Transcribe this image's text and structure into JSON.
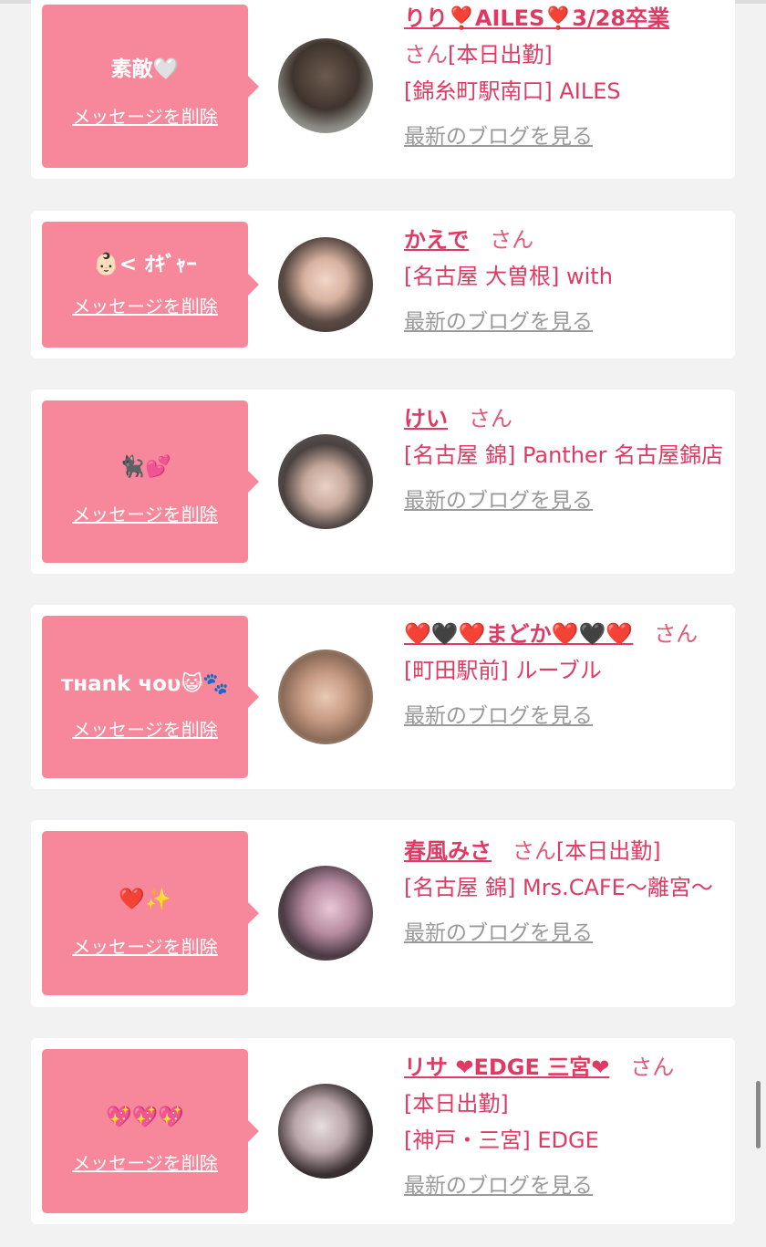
{
  "colors": {
    "bubble": "#f7889b",
    "name_text": "#e03a64",
    "blog_link": "#9a9a9a",
    "background": "#f2f2f2"
  },
  "entries": [
    {
      "message": "素敵🤍",
      "delete_label": "メッセージを削除",
      "name": "りり❣️AILES❣️3/28卒業",
      "san": "さん",
      "status": "[本日出勤]",
      "shop": "[錦糸町駅南口] AILES",
      "blog_label": "最新のブログを見る"
    },
    {
      "message": "👶🏻< ｵｷﾞｬｰ",
      "delete_label": "メッセージを削除",
      "name": "かえで",
      "san": "さん",
      "status": "",
      "shop": "[名古屋 大曽根] with",
      "blog_label": "最新のブログを見る"
    },
    {
      "message": "🐈‍⬛💕",
      "delete_label": "メッセージを削除",
      "name": "けい",
      "san": "さん",
      "status": "",
      "shop": "[名古屋 錦] Panther 名古屋錦店",
      "blog_label": "最新のブログを見る"
    },
    {
      "message": "тнank чoυ😺🐾",
      "delete_label": "メッセージを削除",
      "name": "❤️🖤❤️まどか❤️🖤❤️",
      "san": "さん",
      "status": "",
      "shop": "[町田駅前] ルーブル",
      "blog_label": "最新のブログを見る"
    },
    {
      "message": "❤️✨",
      "delete_label": "メッセージを削除",
      "name": "春風みさ",
      "san": "さん",
      "status": "[本日出勤]",
      "shop": "[名古屋 錦] Mrs.CAFE〜離宮〜",
      "blog_label": "最新のブログを見る"
    },
    {
      "message": "💖💖💖",
      "delete_label": "メッセージを削除",
      "name": "リサ ❤EDGE 三宮❤",
      "san": "さん",
      "status": "[本日出勤]",
      "shop": "[神戸・三宮] EDGE",
      "blog_label": "最新のブログを見る"
    }
  ]
}
